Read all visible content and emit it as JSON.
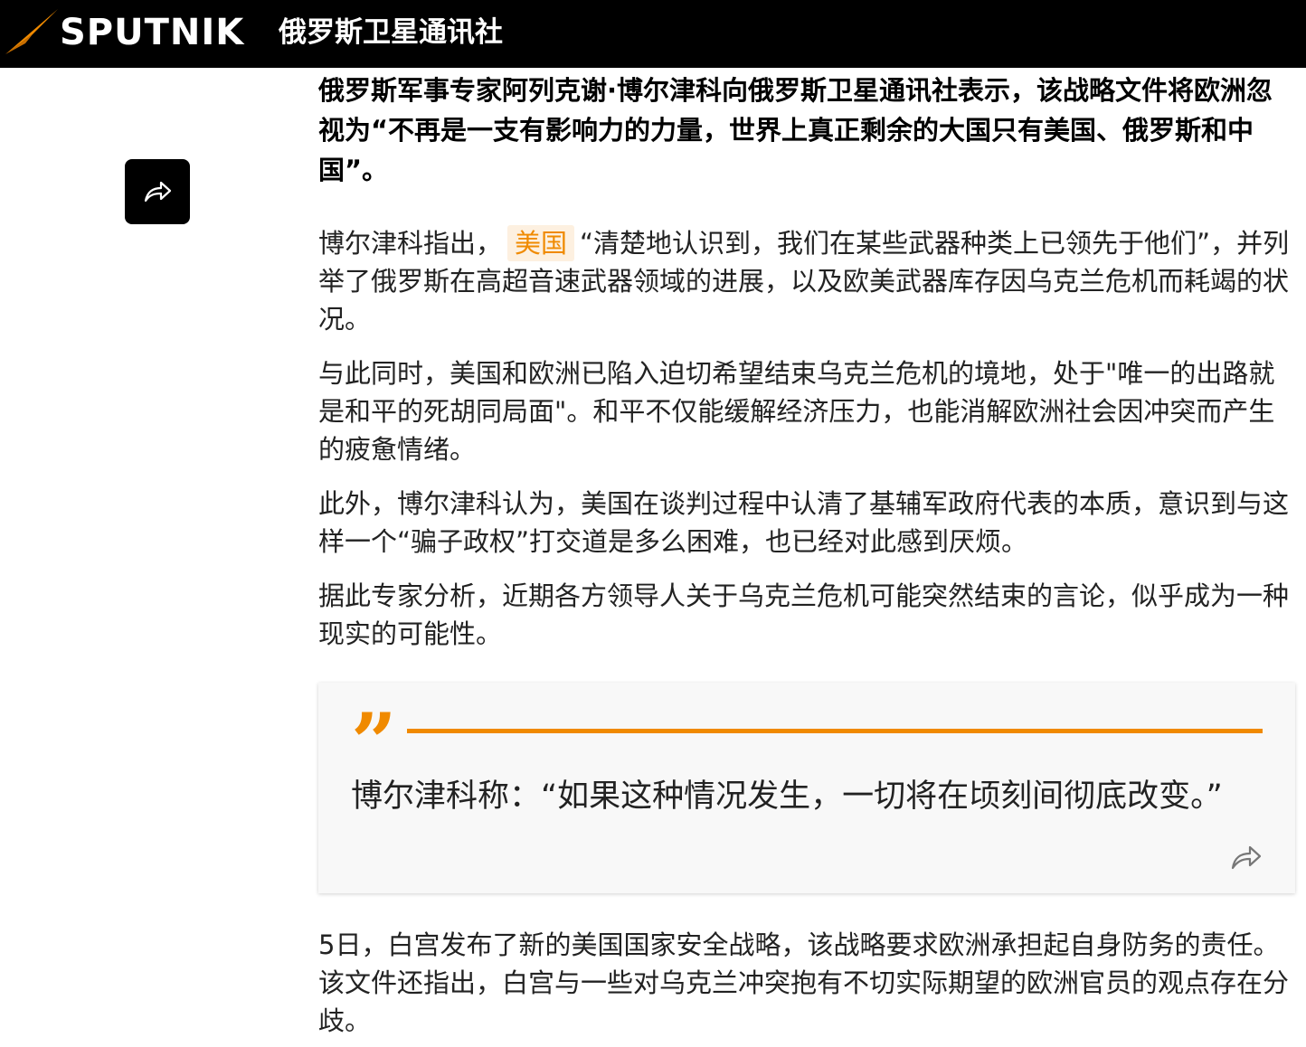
{
  "header": {
    "logo_word": "SPUTNIK",
    "brand_cn": "俄罗斯卫星通讯社",
    "logo_icon": "sputnik-logo-icon",
    "logo_color": "#f08a00"
  },
  "share_button": {
    "icon": "share-arrow-icon"
  },
  "article": {
    "lead": "俄罗斯军事专家阿列克谢·博尔津科向俄罗斯卫星通讯社表示，该战略文件将欧洲忽视为“不再是一支有影响力的力量，世界上真正剩余的大国只有美国、俄罗斯和中国”。",
    "p1_before": "博尔津科指出，",
    "p1_tag": "美国",
    "p1_after": "“清楚地认识到，我们在某些武器种类上已领先于他们”，并列举了俄罗斯在高超音速武器领域的进展，以及欧美武器库存因乌克兰危机而耗竭的状况。",
    "p2": "与此同时，美国和欧洲已陷入迫切希望结束乌克兰危机的境地，处于\"唯一的出路就是和平的死胡同局面\"。和平不仅能缓解经济压力，也能消解欧洲社会因冲突而产生的疲惫情绪。",
    "p3": "此外，博尔津科认为，美国在谈判过程中认清了基辅军政府代表的本质，意识到与这样一个“骗子政权”打交道是多么困难，也已经对此感到厌烦。",
    "p4": "据此专家分析，近期各方领导人关于乌克兰危机可能突然结束的言论，似乎成为一种现实的可能性。",
    "quote": {
      "mark": "”",
      "text": "博尔津科称：“如果这种情况发生，一切将在顷刻间彻底改变。”",
      "accent": "#f08a00",
      "share_icon": "share-arrow-icon"
    },
    "p5": "5日，白宫发布了新的美国国家安全战略，该战略要求欧洲承担起自身防务的责任。该文件还指出，白宫与一些对乌克兰冲突抱有不切实际期望的欧洲官员的观点存在分歧。"
  }
}
